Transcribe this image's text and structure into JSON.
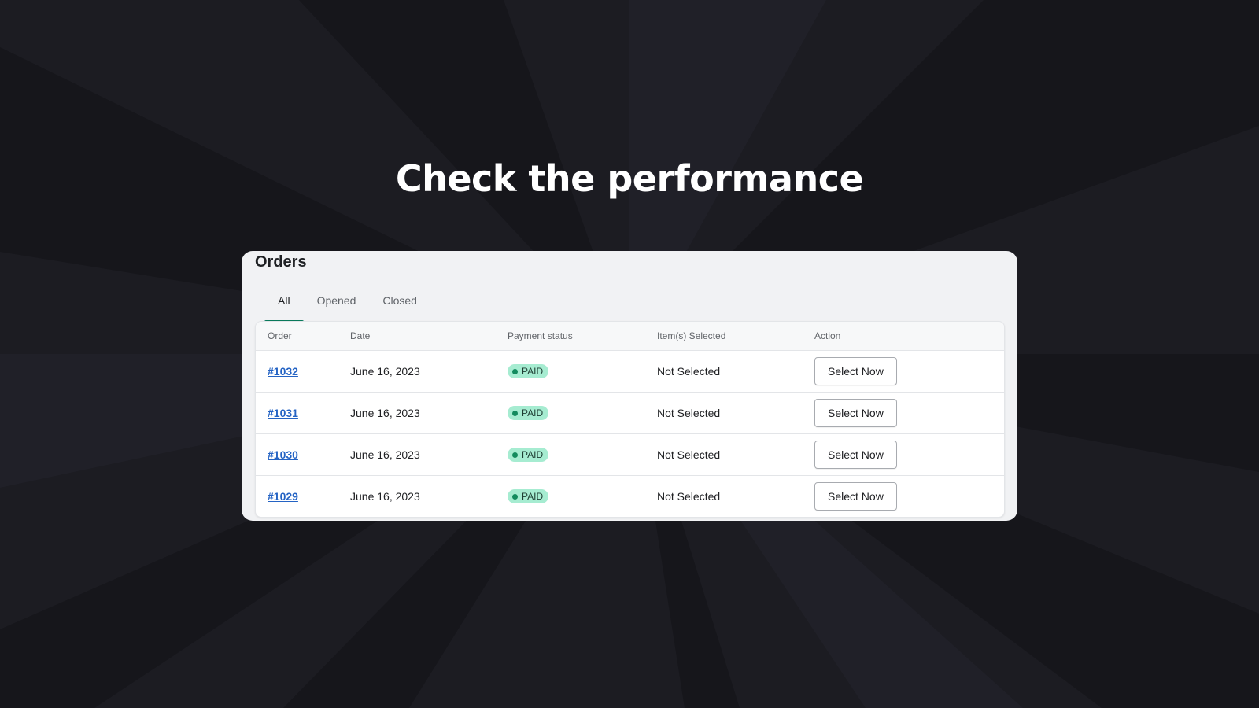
{
  "headline": "Check the performance",
  "colors": {
    "background": "#1c1c22",
    "card": "#f1f2f4",
    "accent_tab": "#0a7a5c",
    "link": "#2463c4",
    "badge_bg": "#a6ecd1",
    "badge_dot": "#138b5e"
  },
  "orders": {
    "title": "Orders",
    "tabs": [
      {
        "label": "All",
        "active": true
      },
      {
        "label": "Opened",
        "active": false
      },
      {
        "label": "Closed",
        "active": false
      }
    ],
    "columns": [
      "Order",
      "Date",
      "Payment status",
      "Item(s) Selected",
      "Action"
    ],
    "rows": [
      {
        "order": "#1032",
        "date": "June 16, 2023",
        "payment_status": "PAID",
        "items": "Not Selected",
        "action": "Select Now"
      },
      {
        "order": "#1031",
        "date": "June 16, 2023",
        "payment_status": "PAID",
        "items": "Not Selected",
        "action": "Select Now"
      },
      {
        "order": "#1030",
        "date": "June 16, 2023",
        "payment_status": "PAID",
        "items": "Not Selected",
        "action": "Select Now"
      },
      {
        "order": "#1029",
        "date": "June 16, 2023",
        "payment_status": "PAID",
        "items": "Not Selected",
        "action": "Select Now"
      }
    ]
  }
}
